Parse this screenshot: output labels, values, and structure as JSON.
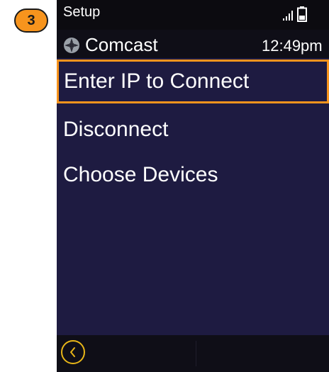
{
  "step_badge": "3",
  "status_bar": {
    "title": "Setup",
    "signal_icon": "signal-bars-icon",
    "battery_icon": "battery-icon"
  },
  "device_row": {
    "icon": "globe-icon",
    "provider": "Comcast",
    "time": "12:49pm"
  },
  "menu": {
    "items": [
      {
        "label": "Enter IP to Connect",
        "selected": true
      },
      {
        "label": "Disconnect",
        "selected": false
      },
      {
        "label": "Choose Devices",
        "selected": false
      }
    ]
  },
  "bottom_bar": {
    "back_icon": "chevron-left-icon"
  },
  "colors": {
    "accent": "#f7941d",
    "screen_bg": "#1e1b41",
    "bar_bg": "#0f0e17",
    "back_ring": "#e7b518",
    "text": "#ffffff"
  }
}
